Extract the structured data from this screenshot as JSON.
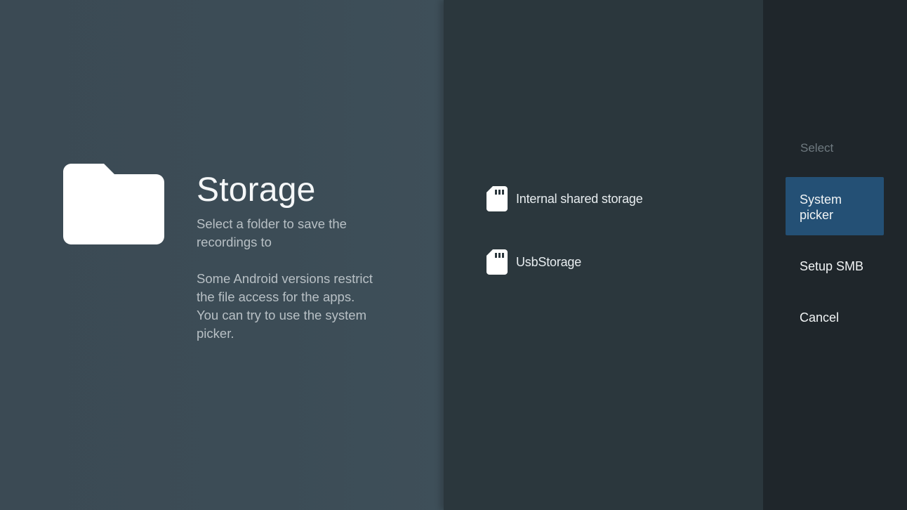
{
  "guidance": {
    "title": "Storage",
    "description": "Select a folder to save the\nrecordings to",
    "note": "Some Android versions restrict\nthe file access for the apps.\nYou can try to use the system\npicker."
  },
  "storage": {
    "items": [
      {
        "label": "Internal shared storage",
        "icon": "sd-card-icon"
      },
      {
        "label": "UsbStorage",
        "icon": "sd-card-icon"
      }
    ]
  },
  "actions": {
    "header": "Select",
    "system_picker": "System\npicker",
    "setup_smb": "Setup SMB",
    "cancel": "Cancel"
  },
  "colors": {
    "guidance_background": "#3c4c56",
    "storage_background": "#2b373d",
    "actions_background": "#1f262b",
    "selected_action_background": "#245075"
  }
}
